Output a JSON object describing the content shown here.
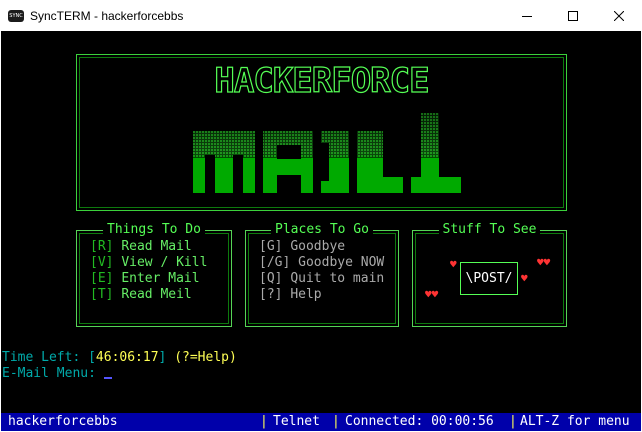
{
  "window": {
    "title": "SyncTERM - hackerforcebbs",
    "icon_text": "SYNC"
  },
  "logo": {
    "wordmark": "HACKERFORCE",
    "mail_art_text": "MAIL"
  },
  "boxes": {
    "things": {
      "title": "Things To Do",
      "items": [
        {
          "key": "[R]",
          "label": "Read Mail"
        },
        {
          "key": "[V]",
          "label": "View / Kill"
        },
        {
          "key": "[E]",
          "label": "Enter Mail"
        },
        {
          "key": "[T]",
          "label": "Read Meil"
        }
      ]
    },
    "places": {
      "title": "Places To Go",
      "items": [
        {
          "key": "[G]",
          "label": "Goodbye"
        },
        {
          "key": "[/G]",
          "label": "Goodbye NOW"
        },
        {
          "key": "[Q]",
          "label": "Quit to main"
        },
        {
          "key": "[?]",
          "label": "Help"
        }
      ]
    },
    "stuff": {
      "title": "Stuff To See",
      "post_label": "\\POST/"
    }
  },
  "prompt": {
    "time_left_label": "Time Left: ",
    "time_left_open": "[",
    "time_left_value": "46:06:17",
    "time_left_close": "]",
    "help_hint": " (?=Help)",
    "menu_label": "E-Mail Menu: "
  },
  "status_bar": {
    "host": "hackerforcebbs",
    "protocol": "Telnet",
    "connected": "Connected: 00:00:56",
    "menu_hint": "ALT-Z for menu",
    "separator": "|"
  },
  "colors": {
    "terminal_bg": "#000000",
    "frame_green": "#55ff55",
    "logo_green": "#00aa00",
    "status_bg": "#0000aa",
    "highlight_yellow": "#ffff55",
    "cyan": "#00aaaa",
    "heart_red": "#ff3333"
  },
  "icons": {
    "minimize": "minimize-icon",
    "maximize": "maximize-icon",
    "close": "close-icon",
    "heart": "heart-icon"
  }
}
